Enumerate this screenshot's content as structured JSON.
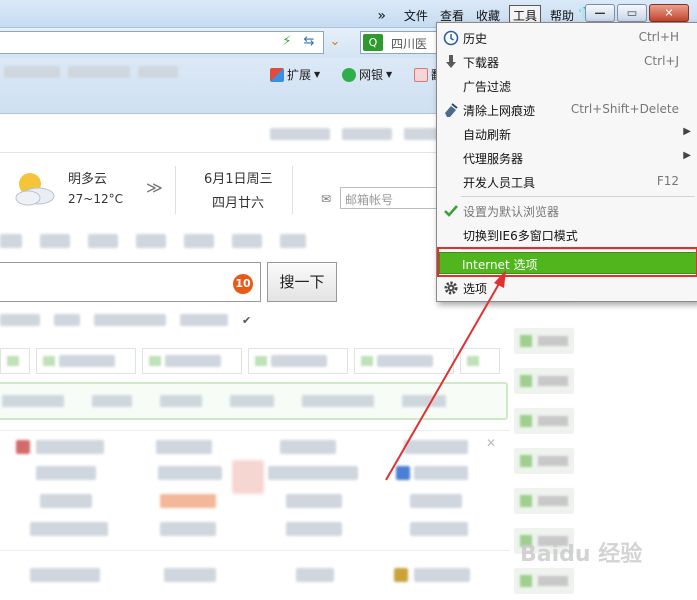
{
  "menubar": {
    "more": "»",
    "items": [
      "文件",
      "查看",
      "收藏",
      "工具",
      "帮助"
    ],
    "active_index": 3
  },
  "window_buttons": {
    "minimize": "—",
    "maximize": "▭",
    "close": "✕"
  },
  "addressbar": {
    "search_value": "四川医"
  },
  "favbar": {
    "expand_label": "扩展",
    "bank_label": "网银",
    "partial_label": "翻"
  },
  "page": {
    "weather_desc": "明多云",
    "weather_temp": "27~12°C",
    "date_line1": "6月1日周三",
    "date_line2": "四月廿六",
    "mail_placeholder": "邮箱帐号",
    "search_badge": "10",
    "search_button": "搜一下",
    "watermark": "Baidu 经验"
  },
  "dropdown": {
    "items": [
      {
        "label": "历史",
        "shortcut": "Ctrl+H",
        "icon": "clock-icon"
      },
      {
        "label": "下载器",
        "shortcut": "Ctrl+J",
        "icon": "download-arrow-icon"
      },
      {
        "label": "广告过滤",
        "shortcut": "",
        "icon": ""
      },
      {
        "label": "清除上网痕迹",
        "shortcut": "Ctrl+Shift+Delete",
        "icon": "eraser-icon"
      },
      {
        "label": "自动刷新",
        "shortcut": "",
        "icon": "",
        "submenu": true
      },
      {
        "label": "代理服务器",
        "shortcut": "",
        "icon": "",
        "submenu": true
      },
      {
        "label": "开发人员工具",
        "shortcut": "F12",
        "icon": ""
      },
      {
        "label": "设置为默认浏览器",
        "shortcut": "",
        "icon": "checkmark-icon",
        "disabled": true
      },
      {
        "label": "切换到IE6多窗口模式",
        "shortcut": "",
        "icon": ""
      },
      {
        "label": "Internet 选项",
        "shortcut": "",
        "icon": "",
        "highlighted": true
      },
      {
        "label": "选项",
        "shortcut": "",
        "icon": "gear-icon"
      }
    ]
  },
  "colors": {
    "highlight_green": "#51b51e",
    "annotation_red": "#e03131",
    "badge_orange": "#e85a1a"
  }
}
